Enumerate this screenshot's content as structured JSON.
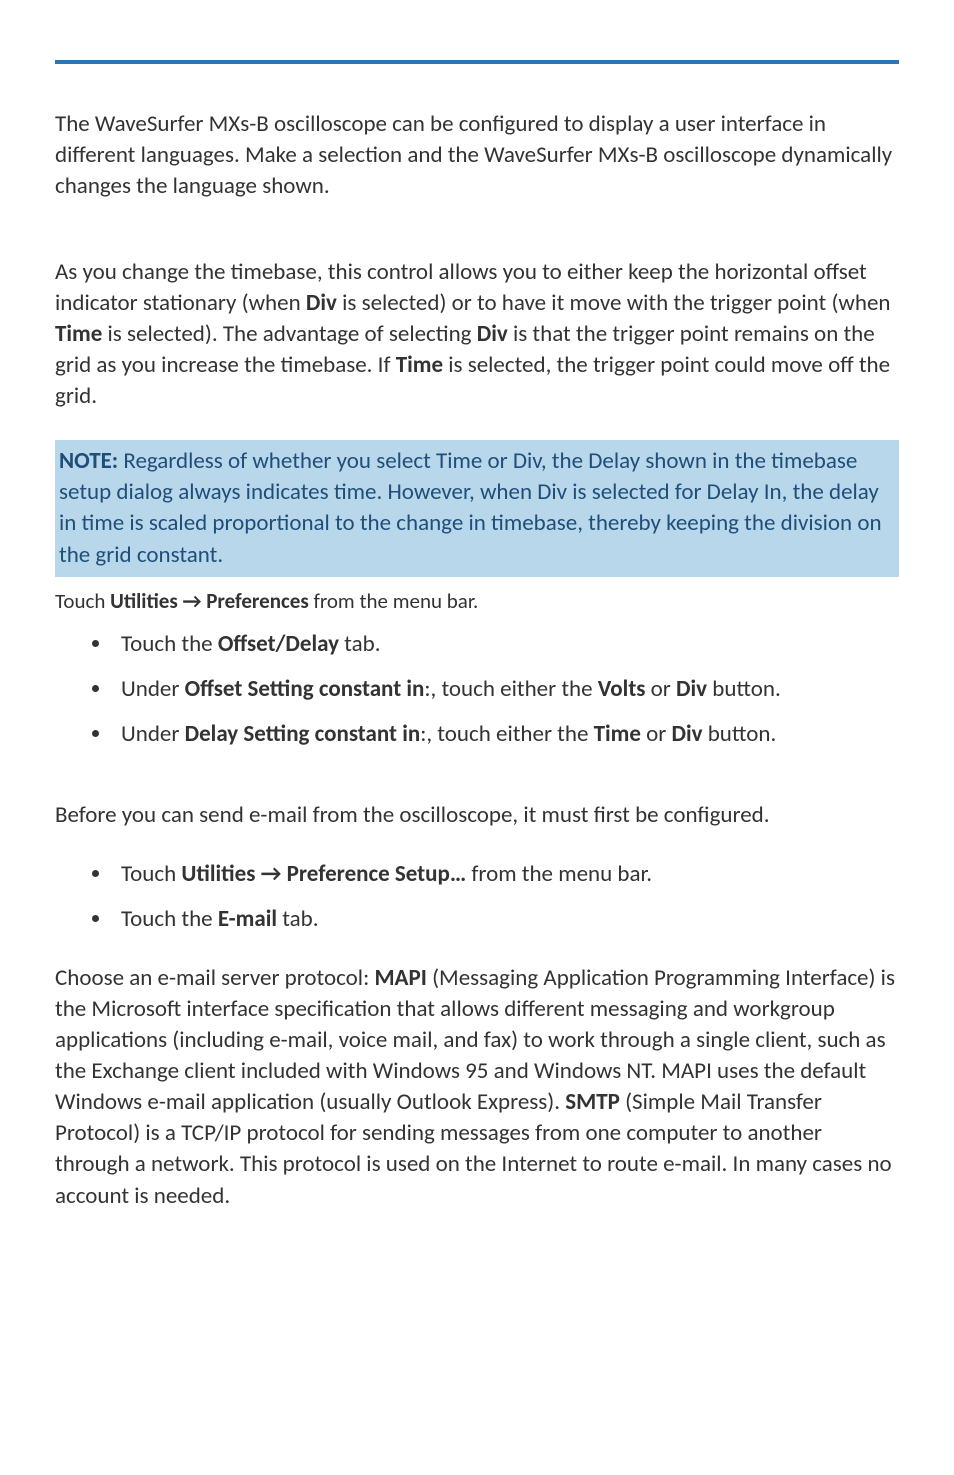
{
  "intro_para": "The WaveSurfer MXs-B oscilloscope can be configured to display a user interface in different languages. Make a selection and the WaveSurfer MXs-B oscilloscope dynamically changes the language shown.",
  "timebase_para": {
    "p1a": "As you change the timebase, this control allows you to either keep the horizontal offset indicator stationary (when ",
    "div1": "Div",
    "p1b": " is selected) or to have it move with the trigger point (when ",
    "time1": "Time",
    "p1c": " is selected). The advantage of selecting ",
    "div2": "Div",
    "p1d": " is that the trigger point remains on the grid as you increase the timebase. If ",
    "time2": "Time",
    "p1e": " is selected, the trigger point could move off the grid."
  },
  "note": {
    "label": "NOTE:",
    "text": " Regardless of whether you select Time or Div, the Delay shown in the timebase setup dialog always indicates time. However, when Div is selected for Delay In, the delay in time is scaled proportional to the change in timebase, thereby keeping the division on the grid constant."
  },
  "menu_path_1": {
    "pre": "Touch ",
    "utilities": "Utilities",
    "arrow": " → ",
    "prefs": "Preferences",
    "post": " from the menu bar."
  },
  "bullets_1": {
    "b1_pre": "Touch the ",
    "b1_bold": "Offset/Delay",
    "b1_post": " tab.",
    "b2_pre": "Under ",
    "b2_bold": "Offset Setting constant in",
    "b2_mid": ":, touch either the ",
    "b2_volts": "Volts",
    "b2_or": " or ",
    "b2_div": "Div",
    "b2_post": " button.",
    "b3_pre": "Under ",
    "b3_bold": "Delay Setting constant in",
    "b3_mid": ":, touch either the ",
    "b3_time": "Time",
    "b3_or": " or ",
    "b3_div": "Div",
    "b3_post": " button."
  },
  "email_intro": "Before you can send e-mail from the oscilloscope, it must first be configured.",
  "bullets_2": {
    "b1_pre": "Touch ",
    "b1_util": "Utilities",
    "b1_arrow": " → ",
    "b1_pref": "Preference Setup…",
    "b1_post": " from the menu bar.",
    "b2_pre": "Touch the ",
    "b2_bold": "E-mail",
    "b2_post": " tab."
  },
  "email_para": {
    "p1": "Choose an e-mail server protocol: ",
    "mapi": "MAPI",
    "p2": " (Messaging Application Programming Interface) is the Microsoft interface specification that allows different messaging and workgroup applications (including e-mail, voice mail, and fax) to work through a single client, such as the Exchange client included with Windows 95 and Windows NT. MAPI uses the default Windows e-mail application (usually Outlook Express). ",
    "smtp": "SMTP",
    "p3": " (Simple Mail Transfer Protocol) is a TCP/IP protocol for sending messages from one computer to another through a network. This protocol is used on the Internet to route e-mail. In many cases no account is needed."
  }
}
